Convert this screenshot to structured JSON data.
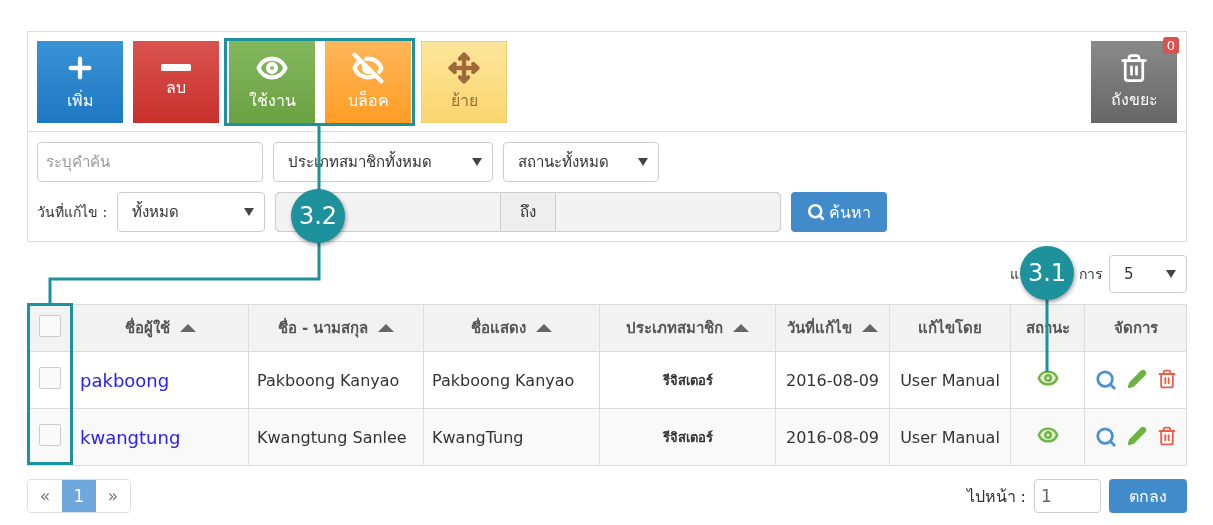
{
  "toolbar": {
    "buttons": [
      {
        "kind": "add",
        "label": "เพิ่ม"
      },
      {
        "kind": "delete",
        "label": "ลบ"
      },
      {
        "kind": "enable",
        "label": "ใช้งาน"
      },
      {
        "kind": "block",
        "label": "บล็อค"
      },
      {
        "kind": "move",
        "label": "ย้าย"
      }
    ],
    "trash": {
      "label": "ถังขยะ",
      "count": "0"
    }
  },
  "filters": {
    "search": {
      "placeholder": "ระบุคำค้น"
    },
    "member_type": "ประเภทสมาชิกทั้งหมด",
    "status": "สถานะทั้งหมด",
    "date_label": "วันที่แก้ไข :",
    "date_range": "ทั้งหมด",
    "to_label": "ถึง",
    "search_button": "ค้นหา"
  },
  "per_page": {
    "label_start": "แ",
    "label_end": "การ",
    "value": "5"
  },
  "table": {
    "select_all": {
      "checked": false
    },
    "columns": [
      {
        "label": "ชื่อผู้ใช้",
        "sortable": true
      },
      {
        "label": "ชื่อ - นามสกุล",
        "sortable": true
      },
      {
        "label": "ชื่อแสดง",
        "sortable": true
      },
      {
        "label": "ประเภทสมาชิก",
        "sortable": true
      },
      {
        "label": "วันที่แก้ไข",
        "sortable": true
      },
      {
        "label": "แก้ไขโดย",
        "sortable": false
      },
      {
        "label": "สถานะ",
        "sortable": false
      },
      {
        "label": "จัดการ",
        "sortable": false
      }
    ],
    "rows": [
      {
        "checked": false,
        "username": "pakboong",
        "full_name": "Pakboong Kanyao",
        "display_name": "Pakboong Kanyao",
        "member_type": "รีจิสเตอร์",
        "modified": "2016-08-09",
        "modified_by": "User Manual",
        "active": true
      },
      {
        "checked": false,
        "username": "kwangtung",
        "full_name": "Kwangtung Sanlee",
        "display_name": "KwangTung",
        "member_type": "รีจิสเตอร์",
        "modified": "2016-08-09",
        "modified_by": "User Manual",
        "active": true
      }
    ]
  },
  "pagination": {
    "prev": "«",
    "pages": [
      {
        "label": "1",
        "selected": true
      }
    ],
    "next": "»",
    "goto_label": "ไปหน้า :",
    "goto_value": "1",
    "go_button": "ตกลง"
  },
  "callouts": [
    {
      "label": "3.2"
    },
    {
      "label": "3.1"
    }
  ]
}
